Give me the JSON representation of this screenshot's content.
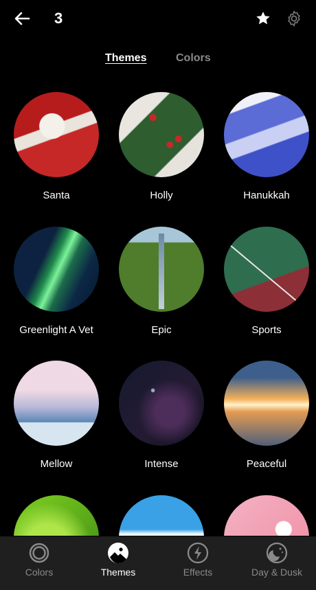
{
  "topbar": {
    "count": "3",
    "back_icon": "arrow-left-icon",
    "star_icon": "star-icon",
    "settings_icon": "gear-icon"
  },
  "tabs": {
    "themes": "Themes",
    "colors": "Colors",
    "active": "Themes"
  },
  "themes": [
    {
      "name": "Santa"
    },
    {
      "name": "Holly"
    },
    {
      "name": "Hanukkah"
    },
    {
      "name": "Greenlight A Vet"
    },
    {
      "name": "Epic"
    },
    {
      "name": "Sports"
    },
    {
      "name": "Mellow"
    },
    {
      "name": "Intense"
    },
    {
      "name": "Peaceful"
    }
  ],
  "nav": [
    {
      "label": "Colors",
      "icon": "ring-icon"
    },
    {
      "label": "Themes",
      "icon": "theme-image-icon",
      "active": true
    },
    {
      "label": "Effects",
      "icon": "lightning-icon"
    },
    {
      "label": "Day & Dusk",
      "icon": "moon-stars-icon"
    }
  ],
  "colors": {
    "background": "#000000",
    "navbar": "#1f1f1f",
    "inactive_text": "#8a8a8a"
  }
}
